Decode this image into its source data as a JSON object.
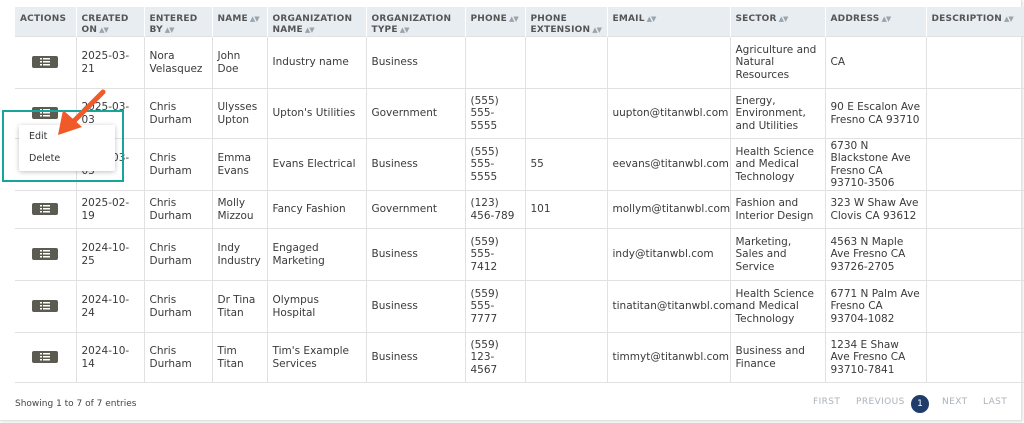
{
  "table": {
    "headers": [
      {
        "label": "ACTIONS",
        "sortable": false
      },
      {
        "label": "CREATED ON",
        "sortable": true
      },
      {
        "label": "ENTERED BY",
        "sortable": true
      },
      {
        "label": "NAME",
        "sortable": true
      },
      {
        "label": "ORGANIZATION NAME",
        "sortable": true
      },
      {
        "label": "ORGANIZATION TYPE",
        "sortable": true
      },
      {
        "label": "PHONE",
        "sortable": true
      },
      {
        "label": "PHONE EXTENSION",
        "sortable": true
      },
      {
        "label": "EMAIL",
        "sortable": true
      },
      {
        "label": "SECTOR",
        "sortable": true
      },
      {
        "label": "ADDRESS",
        "sortable": true
      },
      {
        "label": "DESCRIPTION",
        "sortable": true
      }
    ],
    "rows": [
      {
        "created_on": "2025-03-21",
        "entered_by": "Nora Velasquez",
        "name": "John Doe",
        "org_name": "Industry name",
        "org_type": "Business",
        "phone": "",
        "phone_ext": "",
        "email": "",
        "sector": "Agriculture and Natural Resources",
        "address": "CA",
        "description": ""
      },
      {
        "created_on": "2025-03-03",
        "entered_by": "Chris Durham",
        "name": "Ulysses Upton",
        "org_name": "Upton's Utilities",
        "org_type": "Government",
        "phone": "(555) 555-5555",
        "phone_ext": "",
        "email": "uupton@titanwbl.com",
        "sector": "Energy, Environment, and Utilities",
        "address": "90 E Escalon Ave Fresno CA 93710",
        "description": ""
      },
      {
        "created_on": "2025-03-03",
        "entered_by": "Chris Durham",
        "name": "Emma Evans",
        "org_name": "Evans Electrical",
        "org_type": "Business",
        "phone": "(555) 555-5555",
        "phone_ext": "55",
        "email": "eevans@titanwbl.com",
        "sector": "Health Science and Medical Technology",
        "address": "6730 N Blackstone Ave Fresno CA 93710-3506",
        "description": ""
      },
      {
        "created_on": "2025-02-19",
        "entered_by": "Chris Durham",
        "name": "Molly Mizzou",
        "org_name": "Fancy Fashion",
        "org_type": "Government",
        "phone": "(123) 456-789",
        "phone_ext": "101",
        "email": "mollym@titanwbl.com",
        "sector": "Fashion and Interior Design",
        "address": "323 W Shaw Ave Clovis CA 93612",
        "description": ""
      },
      {
        "created_on": "2024-10-25",
        "entered_by": "Chris Durham",
        "name": "Indy Industry",
        "org_name": "Engaged Marketing",
        "org_type": "Business",
        "phone": "(559) 555-7412",
        "phone_ext": "",
        "email": "indy@titanwbl.com",
        "sector": "Marketing, Sales and Service",
        "address": "4563 N Maple Ave Fresno CA 93726-2705",
        "description": ""
      },
      {
        "created_on": "2024-10-24",
        "entered_by": "Chris Durham",
        "name": "Dr Tina Titan",
        "org_name": "Olympus Hospital",
        "org_type": "Business",
        "phone": "(559) 555-7777",
        "phone_ext": "",
        "email": "tinatitan@titanwbl.com",
        "sector": "Health Science and Medical Technology",
        "address": "6771 N Palm Ave Fresno CA 93704-1082",
        "description": ""
      },
      {
        "created_on": "2024-10-14",
        "entered_by": "Chris Durham",
        "name": "Tim Titan",
        "org_name": "Tim's Example Services",
        "org_type": "Business",
        "phone": "(559) 123-4567",
        "phone_ext": "",
        "email": "timmyt@titanwbl.com",
        "sector": "Business and Finance",
        "address": "1234 E Shaw Ave Fresno CA 93710-7841",
        "description": ""
      }
    ]
  },
  "action_menu": {
    "items": [
      "Edit",
      "Delete"
    ]
  },
  "footer": {
    "info": "Showing 1 to 7 of 7 entries"
  },
  "pagination": {
    "first": "FIRST",
    "previous": "PREVIOUS",
    "current": "1",
    "next": "NEXT",
    "last": "LAST"
  },
  "colors": {
    "header_bg": "#e8edf2",
    "action_button": "#5b5b52",
    "page_current": "#1f3c6b",
    "highlight": "#17a59a",
    "arrow": "#f05a28"
  }
}
